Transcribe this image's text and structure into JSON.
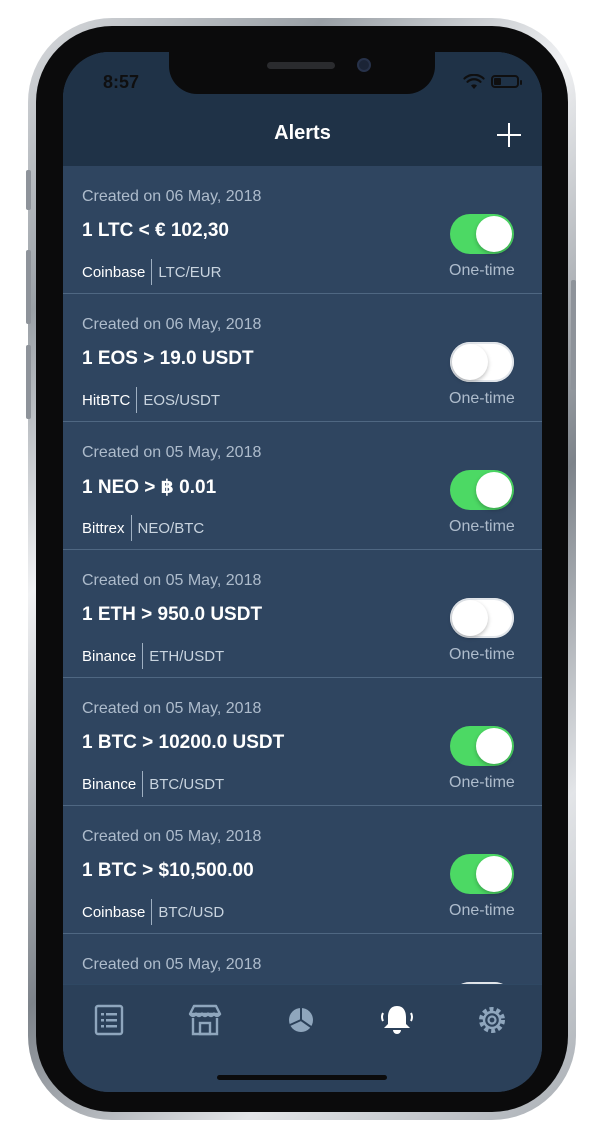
{
  "status_bar": {
    "time": "8:57"
  },
  "nav": {
    "title": "Alerts",
    "add_icon": "plus-icon"
  },
  "alerts": [
    {
      "date": "Created on 06 May, 2018",
      "condition": "1 LTC  < € 102,30",
      "exchange": "Coinbase",
      "pair": "LTC/EUR",
      "enabled": true,
      "type": "One-time"
    },
    {
      "date": "Created on 06 May, 2018",
      "condition": "1 EOS > 19.0 USDT",
      "exchange": "HitBTC",
      "pair": "EOS/USDT",
      "enabled": false,
      "type": "One-time"
    },
    {
      "date": "Created on 05 May, 2018",
      "condition": "1 NEO > ฿ 0.01",
      "exchange": "Bittrex",
      "pair": "NEO/BTC",
      "enabled": true,
      "type": "One-time"
    },
    {
      "date": "Created on 05 May, 2018",
      "condition": "1 ETH > 950.0 USDT",
      "exchange": "Binance",
      "pair": "ETH/USDT",
      "enabled": false,
      "type": "One-time"
    },
    {
      "date": "Created on 05 May, 2018",
      "condition": "1 BTC > 10200.0 USDT",
      "exchange": "Binance",
      "pair": "BTC/USDT",
      "enabled": true,
      "type": "One-time"
    },
    {
      "date": "Created on 05 May, 2018",
      "condition": "1 BTC > $10,500.00",
      "exchange": "Coinbase",
      "pair": "BTC/USD",
      "enabled": true,
      "type": "One-time"
    },
    {
      "date": "Created on 05 May, 2018",
      "condition": "",
      "exchange": "",
      "pair": "",
      "enabled": false,
      "type": ""
    }
  ],
  "tabs": [
    {
      "icon": "list-icon"
    },
    {
      "icon": "store-icon"
    },
    {
      "icon": "pie-chart-icon"
    },
    {
      "icon": "bell-icon"
    },
    {
      "icon": "gear-icon"
    }
  ],
  "colors": {
    "toggle_on": "#4cd964",
    "background": "#2f4560",
    "bar": "#1f3247"
  }
}
